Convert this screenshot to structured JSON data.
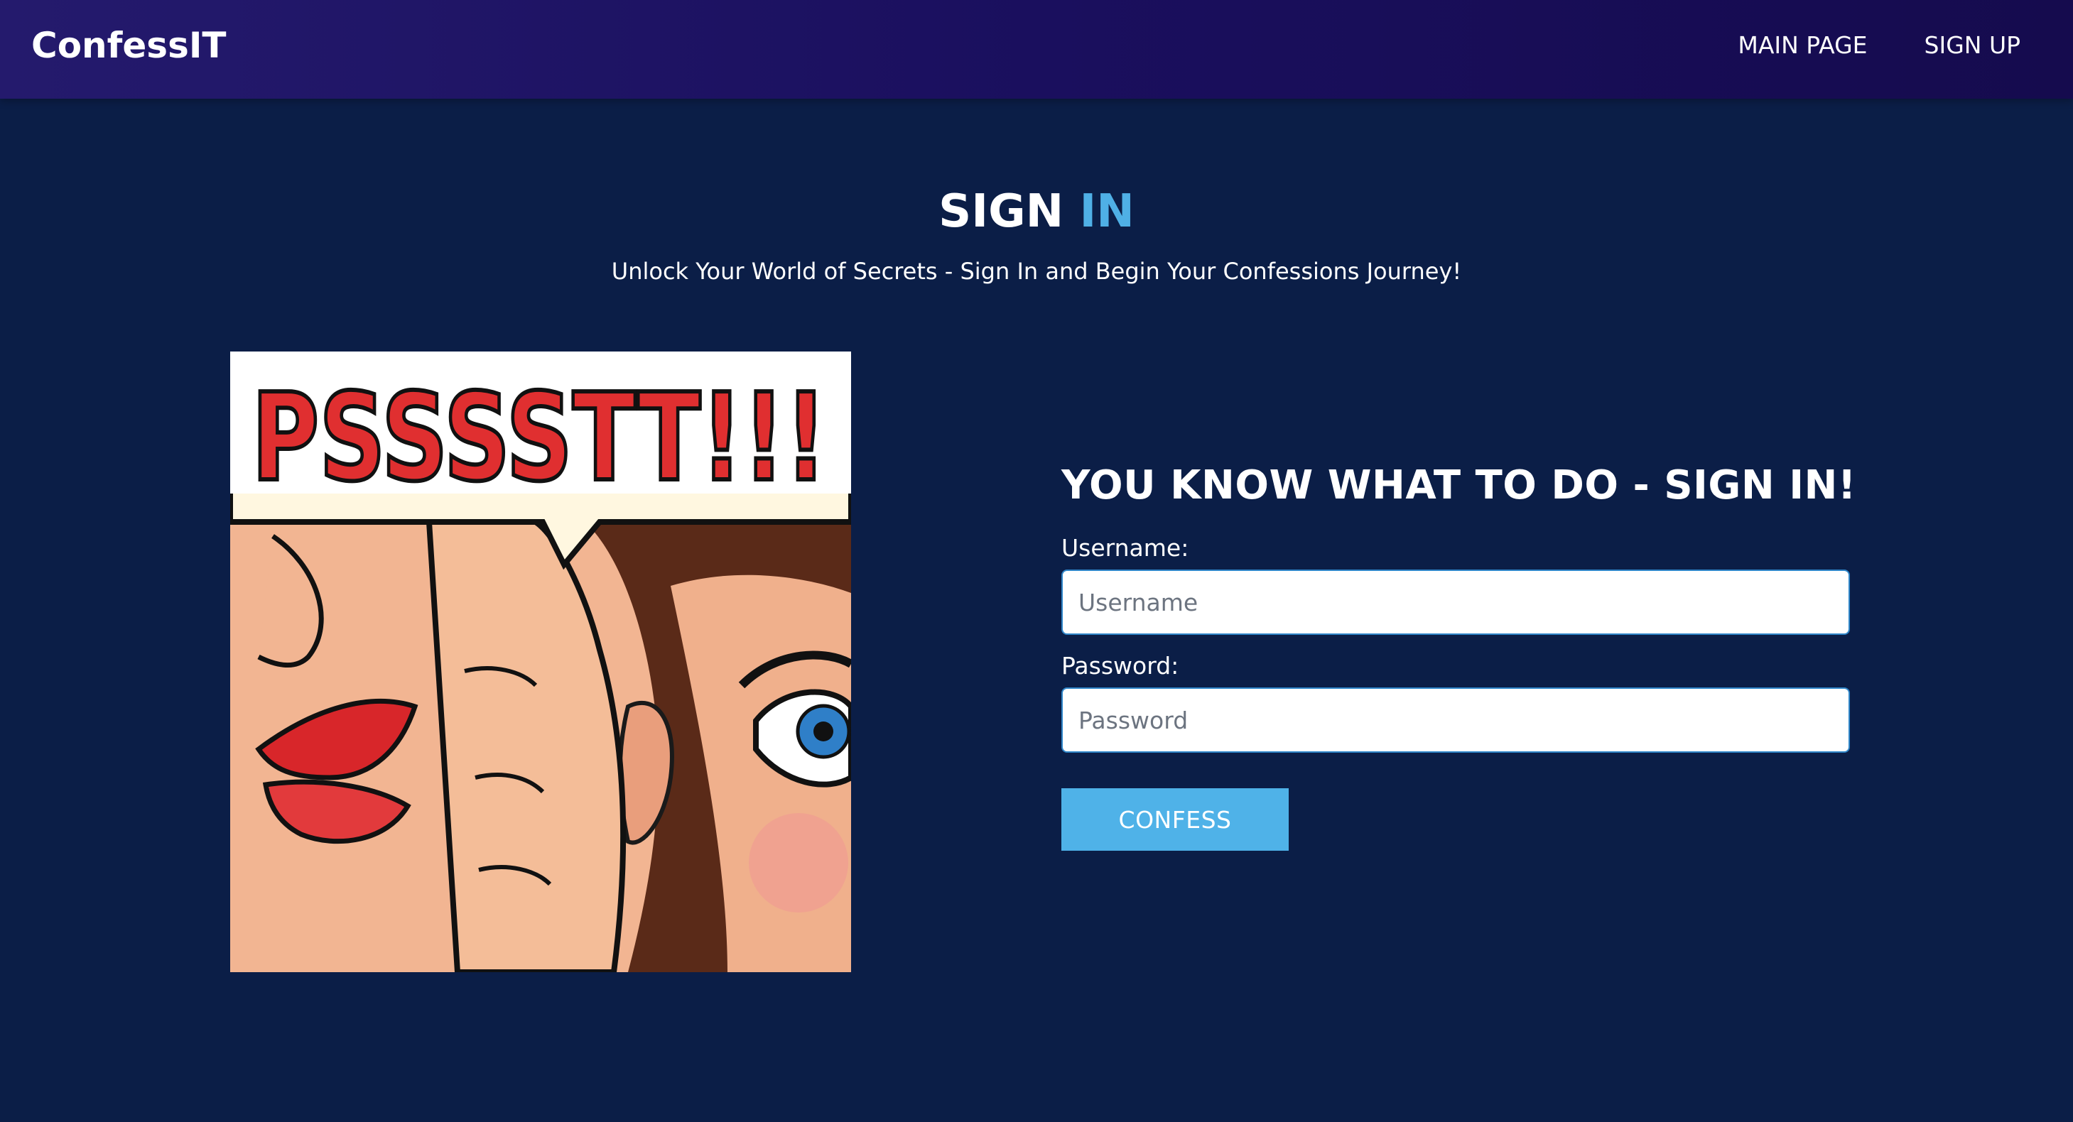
{
  "navbar": {
    "brand": "ConfessIT",
    "links": [
      {
        "label": "MAIN PAGE"
      },
      {
        "label": "SIGN UP"
      }
    ]
  },
  "hero": {
    "title_part1": "SIGN",
    "title_part2": "IN",
    "subtitle": "Unlock Your World of Secrets - Sign In and Begin Your Confessions Journey!"
  },
  "illustration": {
    "speech_text": "PSSSSTT!!!"
  },
  "form": {
    "heading": "YOU KNOW WHAT TO DO - SIGN IN!",
    "username_label": "Username:",
    "username_placeholder": "Username",
    "username_value": "",
    "password_label": "Password:",
    "password_placeholder": "Password",
    "password_value": "",
    "submit_label": "CONFESS"
  },
  "colors": {
    "page_background": "#0b1e47",
    "navbar_background": "#1a0f5e",
    "accent": "#4fb0e6",
    "button": "#4fb2e8"
  }
}
